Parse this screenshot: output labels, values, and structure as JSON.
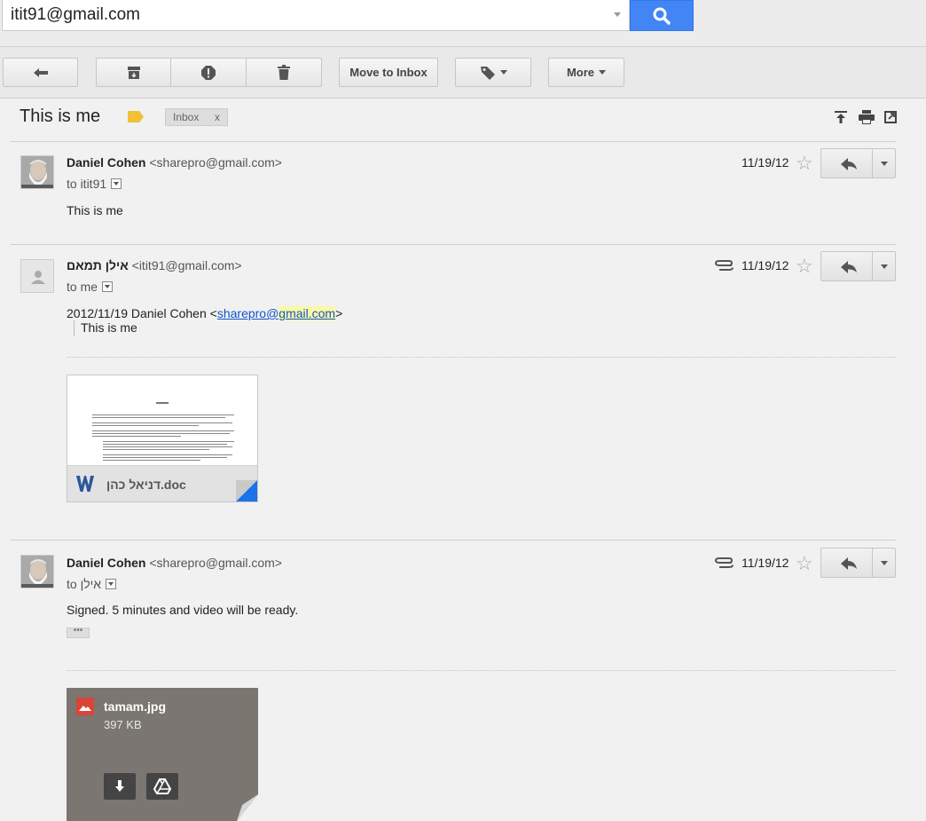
{
  "search": {
    "value": "itit91@gmail.com"
  },
  "toolbar": {
    "move_to_inbox": "Move to Inbox",
    "more": "More"
  },
  "thread": {
    "subject": "This is me",
    "label": "Inbox",
    "label_remove": "x"
  },
  "messages": [
    {
      "sender_name": "Daniel Cohen",
      "sender_email": "<sharepro@gmail.com>",
      "to": "to itit91",
      "date": "11/19/12",
      "body": "This is me"
    },
    {
      "sender_name": "אילן תמאם",
      "sender_email": "<itit91@gmail.com>",
      "to": "to me",
      "date": "11/19/12",
      "quote_header_prefix": "2012/11/19 Daniel Cohen <",
      "quote_link_user": "sharepro@",
      "quote_link_domain": "gmail.com",
      "quote_header_suffix": ">",
      "quote_body": "This is me",
      "attachment": {
        "filename": "דניאל כהן.doc",
        "icon": "word-icon"
      }
    },
    {
      "sender_name": "Daniel Cohen",
      "sender_email": "<sharepro@gmail.com>",
      "to": "to אילן",
      "date": "11/19/12",
      "body": "Signed.  5 minutes and video will be ready.",
      "attachment": {
        "filename": "tamam.jpg",
        "size": "397 KB",
        "icon": "image-icon"
      }
    }
  ],
  "colors": {
    "search_button": "#4385f5",
    "label_marker": "#f2c037",
    "link": "#1155cc",
    "highlight": "#fcf8a4"
  }
}
